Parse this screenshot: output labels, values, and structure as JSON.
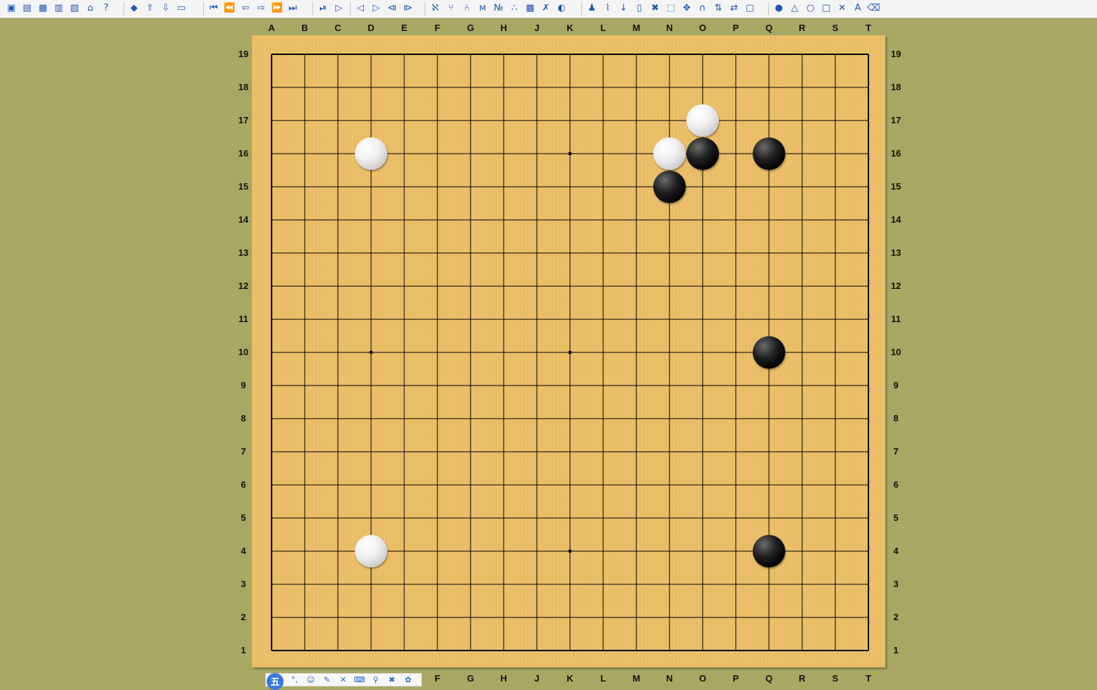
{
  "toolbar": {
    "groups": [
      [
        {
          "name": "new-file-icon",
          "glyph": "▣"
        },
        {
          "name": "open-file-icon",
          "glyph": "▤"
        },
        {
          "name": "save-file-icon",
          "glyph": "▦"
        },
        {
          "name": "database-icon",
          "glyph": "▥"
        },
        {
          "name": "print-icon",
          "glyph": "▧"
        },
        {
          "name": "home-icon",
          "glyph": "⌂"
        },
        {
          "name": "help-icon",
          "glyph": "?"
        }
      ],
      [
        {
          "name": "book-icon",
          "glyph": "◆"
        },
        {
          "name": "up-arrow-icon",
          "glyph": "⇧"
        },
        {
          "name": "down-arrow-icon",
          "glyph": "⇩"
        },
        {
          "name": "folder-icon",
          "glyph": "▭"
        }
      ],
      [
        {
          "name": "first-move-icon",
          "glyph": "⏮"
        },
        {
          "name": "back-ten-icon",
          "glyph": "⏪"
        },
        {
          "name": "back-one-icon",
          "glyph": "⇦"
        },
        {
          "name": "forward-one-icon",
          "glyph": "⇨"
        },
        {
          "name": "forward-ten-icon",
          "glyph": "⏩"
        },
        {
          "name": "last-move-icon",
          "glyph": "⏭"
        }
      ],
      [
        {
          "name": "autoplay-icon",
          "glyph": "⏯"
        },
        {
          "name": "play-icon",
          "glyph": "▷"
        }
      ],
      [
        {
          "name": "prev-variation-icon",
          "glyph": "◁"
        },
        {
          "name": "next-variation-icon",
          "glyph": "▷"
        },
        {
          "name": "first-variation-icon",
          "glyph": "⧏"
        },
        {
          "name": "last-variation-icon",
          "glyph": "⧐"
        }
      ],
      [
        {
          "name": "tree-icon",
          "glyph": "ℵ"
        },
        {
          "name": "branch-icon",
          "glyph": "⑂"
        },
        {
          "name": "merge-icon",
          "glyph": "⑃"
        },
        {
          "name": "text-mg-icon",
          "glyph": "ᴍ"
        },
        {
          "name": "move-number-icon",
          "glyph": "№"
        },
        {
          "name": "cluster-icon",
          "glyph": "∴"
        },
        {
          "name": "grid-icon",
          "glyph": "▩"
        },
        {
          "name": "delete-branch-icon",
          "glyph": "✗"
        },
        {
          "name": "globe-icon",
          "glyph": "◐"
        }
      ],
      [
        {
          "name": "stamp-icon",
          "glyph": "♟"
        },
        {
          "name": "link-icon",
          "glyph": "⌇"
        },
        {
          "name": "download-icon",
          "glyph": "↓"
        },
        {
          "name": "document-icon",
          "glyph": "▯"
        },
        {
          "name": "remove-icon",
          "glyph": "✖"
        },
        {
          "name": "select-rect-icon",
          "glyph": "⬚"
        },
        {
          "name": "move-cross-icon",
          "glyph": "✥"
        },
        {
          "name": "magnet-icon",
          "glyph": "∩"
        },
        {
          "name": "swap-vertical-icon",
          "glyph": "⇅"
        },
        {
          "name": "swap-horizontal-icon",
          "glyph": "⇄"
        },
        {
          "name": "window-icon",
          "glyph": "▢"
        }
      ],
      [
        {
          "name": "stone-tool-icon",
          "glyph": "●"
        },
        {
          "name": "triangle-mark-icon",
          "glyph": "△"
        },
        {
          "name": "circle-mark-icon",
          "glyph": "○"
        },
        {
          "name": "square-mark-icon",
          "glyph": "□"
        },
        {
          "name": "cross-mark-icon",
          "glyph": "✕"
        },
        {
          "name": "letter-mark-icon",
          "glyph": "A"
        },
        {
          "name": "eraser-icon",
          "glyph": "⌫"
        }
      ]
    ]
  },
  "board": {
    "size": 19,
    "columns": [
      "A",
      "B",
      "C",
      "D",
      "E",
      "F",
      "G",
      "H",
      "J",
      "K",
      "L",
      "M",
      "N",
      "O",
      "P",
      "Q",
      "R",
      "S",
      "T"
    ],
    "rows": [
      "19",
      "18",
      "17",
      "16",
      "15",
      "14",
      "13",
      "12",
      "11",
      "10",
      "9",
      "8",
      "7",
      "6",
      "5",
      "4",
      "3",
      "2",
      "1"
    ],
    "bottom_columns": [
      "F",
      "G",
      "H",
      "J",
      "K",
      "L",
      "M",
      "N",
      "O",
      "P",
      "Q",
      "R",
      "S",
      "T"
    ],
    "star_points": [
      "K16",
      "D10",
      "K10",
      "K4"
    ],
    "stones": [
      {
        "color": "white",
        "point": "O17"
      },
      {
        "color": "white",
        "point": "D16"
      },
      {
        "color": "white",
        "point": "N16"
      },
      {
        "color": "black",
        "point": "O16"
      },
      {
        "color": "black",
        "point": "Q16"
      },
      {
        "color": "black",
        "point": "N15"
      },
      {
        "color": "black",
        "point": "Q10"
      },
      {
        "color": "white",
        "point": "D4"
      },
      {
        "color": "black",
        "point": "Q4"
      }
    ]
  },
  "ime_bar": {
    "logo": "五",
    "buttons": [
      {
        "name": "ime-punctuation-icon",
        "glyph": "°,"
      },
      {
        "name": "ime-emoji-icon",
        "glyph": "☺"
      },
      {
        "name": "ime-pen-icon",
        "glyph": "✎"
      },
      {
        "name": "ime-tools-icon",
        "glyph": "✕"
      },
      {
        "name": "ime-keyboard-icon",
        "glyph": "⌨"
      },
      {
        "name": "ime-user-icon",
        "glyph": "⚲"
      },
      {
        "name": "ime-skin-icon",
        "glyph": "✖"
      },
      {
        "name": "ime-settings-icon",
        "glyph": "✿"
      }
    ]
  }
}
